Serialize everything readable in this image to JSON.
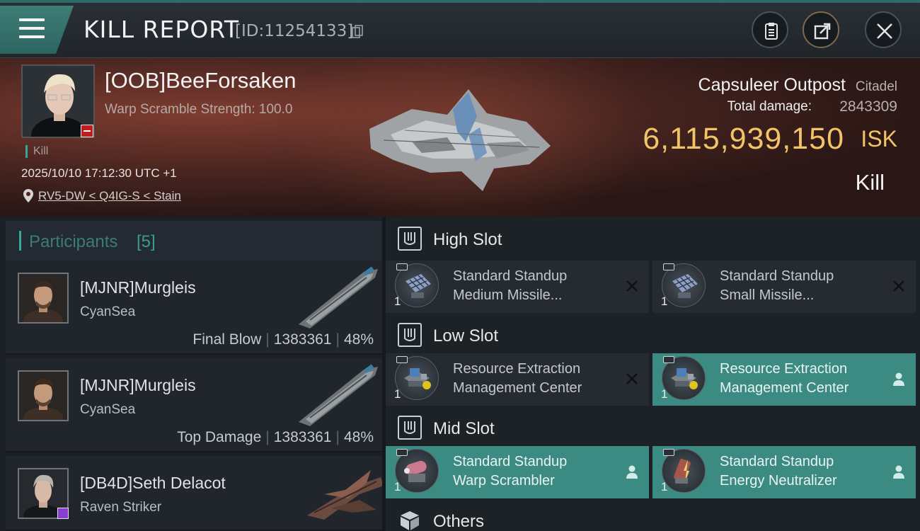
{
  "header": {
    "title": "KILL REPORT",
    "report_id": "[ID:11254133]"
  },
  "victim": {
    "name": "[OOB]BeeForsaken",
    "warp_scramble": "Warp Scramble Strength: 100.0",
    "kill_tag": "Kill",
    "timestamp": "2025/10/10 17:12:30 UTC +1",
    "location": "RV5-DW < Q4IG-S < Stain",
    "ship_name": "Capsuleer Outpost",
    "ship_class": "Citadel",
    "total_damage_label": "Total damage:",
    "total_damage": "2843309",
    "isk_value": "6,115,939,150",
    "isk_unit": "ISK",
    "result": "Kill"
  },
  "participants": {
    "title": "Participants",
    "count": "[5]",
    "rows": [
      {
        "name": "[MJNR]Murgleis",
        "ship": "CyanSea",
        "role": "Final Blow",
        "damage": "1383361",
        "percent": "48%"
      },
      {
        "name": "[MJNR]Murgleis",
        "ship": "CyanSea",
        "role": "Top Damage",
        "damage": "1383361",
        "percent": "48%"
      },
      {
        "name": "[DB4D]Seth Delacot",
        "ship": "Raven Striker",
        "role": "",
        "damage": "",
        "percent": ""
      }
    ]
  },
  "fitting": {
    "high": {
      "label": "High Slot",
      "modules": [
        {
          "line1": "Standard Standup",
          "line2": "Medium Missile...",
          "qty": "1",
          "status": "destroyed"
        },
        {
          "line1": "Standard Standup",
          "line2": "Small Missile...",
          "qty": "1",
          "status": "destroyed"
        }
      ]
    },
    "low": {
      "label": "Low Slot",
      "modules": [
        {
          "line1": "Resource Extraction",
          "line2": "Management Center",
          "qty": "1",
          "status": "destroyed"
        },
        {
          "line1": "Resource Extraction",
          "line2": "Management Center",
          "qty": "1",
          "status": "dropped"
        }
      ]
    },
    "mid": {
      "label": "Mid Slot",
      "modules": [
        {
          "line1": "Standard Standup",
          "line2": "Warp Scrambler",
          "qty": "1",
          "status": "dropped"
        },
        {
          "line1": "Standard Standup",
          "line2": "Energy Neutralizer",
          "qty": "1",
          "status": "dropped"
        }
      ]
    },
    "others": {
      "label": "Others"
    }
  },
  "colors": {
    "accent": "#3b8b82",
    "isk": "#f2c468",
    "banner": "#4b2621"
  }
}
